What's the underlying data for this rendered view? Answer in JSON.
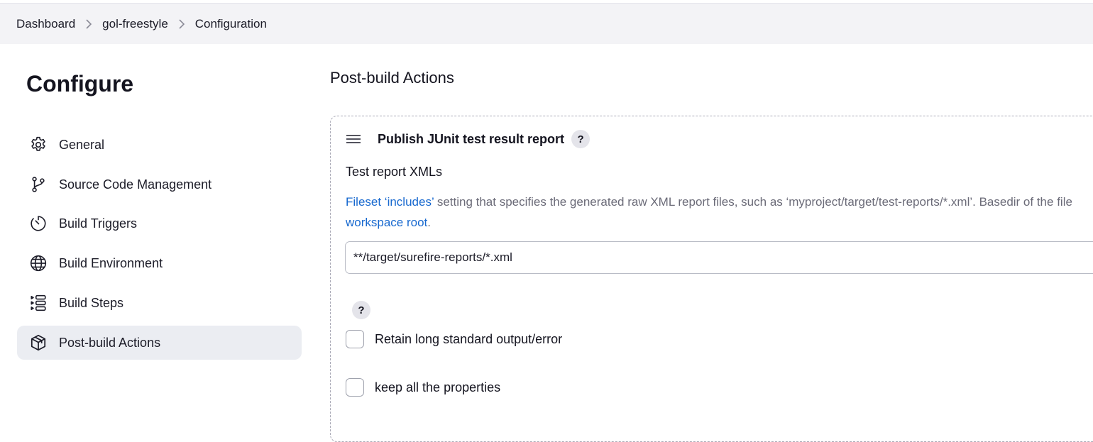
{
  "breadcrumb": {
    "items": [
      "Dashboard",
      "gol-freestyle",
      "Configuration"
    ]
  },
  "sidebar": {
    "title": "Configure",
    "items": [
      {
        "label": "General",
        "icon": "gear-icon"
      },
      {
        "label": "Source Code Management",
        "icon": "git-branch-icon"
      },
      {
        "label": "Build Triggers",
        "icon": "timer-icon"
      },
      {
        "label": "Build Environment",
        "icon": "globe-icon"
      },
      {
        "label": "Build Steps",
        "icon": "list-steps-icon"
      },
      {
        "label": "Post-build Actions",
        "icon": "package-icon",
        "active": true
      }
    ]
  },
  "main": {
    "section_title": "Post-build Actions",
    "action": {
      "title": "Publish JUnit test result report",
      "help": "?",
      "field_label": "Test report XMLs",
      "description": {
        "link1": "Fileset ‘includes’",
        "text1": " setting that specifies the generated raw XML report files, such as ‘myproject/target/test-reports/*.xml’. Basedir of the file",
        "link2": "workspace root",
        "text2": "."
      },
      "input_value": "**/target/surefire-reports/*.xml",
      "help2": "?",
      "checkboxes": [
        {
          "label": "Retain long standard output/error",
          "checked": false
        },
        {
          "label": "keep all the properties",
          "checked": false
        }
      ]
    }
  },
  "colors": {
    "accent_link": "#1869cf",
    "active_bg": "#ebedf2",
    "breadcrumb_bg": "#f3f3f6"
  }
}
